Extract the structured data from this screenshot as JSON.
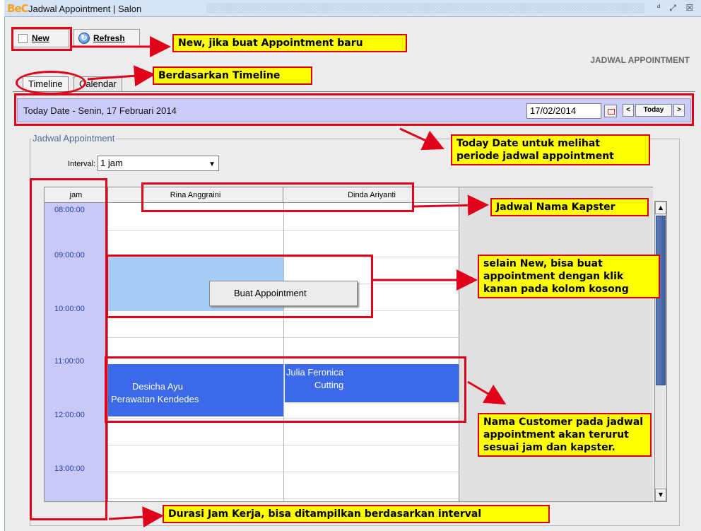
{
  "window": {
    "logo": "BeC",
    "title": "Jadwal Appointment | Salon",
    "controls": {
      "restore": "ᵈ",
      "maximize": "⤢",
      "close": "☒"
    }
  },
  "toolbar": {
    "new_label": "New",
    "refresh_label": "Refresh"
  },
  "section_title": "JADWAL APPOINTMENT",
  "tabs": [
    {
      "label": "Timeline",
      "active": true
    },
    {
      "label": "Calendar",
      "active": false
    }
  ],
  "date_bar": {
    "text": "Today Date - Senin, 17 Februari 2014",
    "date_value": "17/02/2014",
    "prev_label": "<",
    "today_label": "Today",
    "next_label": ">"
  },
  "group": {
    "legend": "Jadwal Appointment",
    "interval_label": "Interval:",
    "interval_value": "1 jam"
  },
  "schedule": {
    "headers": [
      "jam",
      "Rina Anggraini",
      "Dinda Ariyanti"
    ],
    "times": [
      "08:00:00",
      "09:00:00",
      "10:00:00",
      "11:00:00",
      "12:00:00",
      "13:00:00"
    ],
    "appointments": [
      {
        "customer": "Desicha Ayu",
        "service": "Perawatan Kendedes",
        "kapster": "Rina Anggraini"
      },
      {
        "customer": "Julia Feronica",
        "service": "Cutting",
        "kapster": "Dinda Ariyanti"
      }
    ],
    "context_menu": "Buat Appointment"
  },
  "annotations": {
    "new": "New, jika buat Appointment baru",
    "timeline": "Berdasarkan Timeline",
    "today": "Today Date untuk melihat periode jadwal appointment",
    "kapster": "Jadwal Nama Kapster",
    "context": "selain New, bisa buat appointment dengan klik kanan pada kolom kosong",
    "customer": "Nama Customer pada jadwal appointment akan terurut sesuai jam dan kapster.",
    "durasi": "Durasi Jam Kerja, bisa ditampilkan berdasarkan interval"
  },
  "colors": {
    "annotation_red": "#e0001b",
    "note_yellow": "#ffff00",
    "appointment_blue": "#3b69e8",
    "selection_blue": "#a6cdf5",
    "time_column": "#c9c9f7",
    "date_bar": "#ccccf8"
  }
}
